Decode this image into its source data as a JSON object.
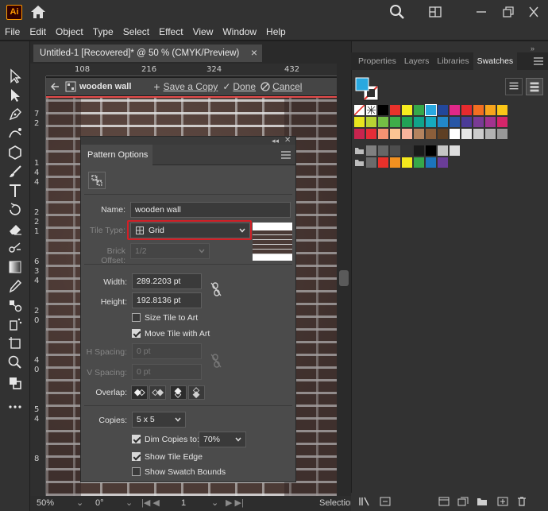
{
  "app": {
    "logo": "Ai",
    "menu": [
      "File",
      "Edit",
      "Object",
      "Type",
      "Select",
      "Effect",
      "View",
      "Window",
      "Help"
    ]
  },
  "document": {
    "tab_title": "Untitled-1 [Recovered]* @ 50 % (CMYK/Preview)",
    "close_glyph": "×"
  },
  "rulers": {
    "h_ticks": [
      "108",
      "216",
      "324",
      "432"
    ],
    "v_ticks": [
      "7",
      "2",
      "1",
      "4",
      "4",
      "2",
      "2",
      "1",
      "6",
      "3",
      "4",
      "2",
      "0",
      "4",
      "0",
      "5",
      "4",
      "8"
    ]
  },
  "pattern_bar": {
    "name": "wooden wall",
    "save_copy": "Save a Copy",
    "done": "Done",
    "cancel": "Cancel"
  },
  "status": {
    "zoom": "50%",
    "rotate": "0°",
    "page": "1",
    "tool": "Selection"
  },
  "dialog": {
    "title": "Pattern Options",
    "name_label": "Name:",
    "name_value": "wooden wall",
    "tile_type_label": "Tile Type:",
    "tile_type_value": "Grid",
    "brick_offset_label": "Brick Offset:",
    "brick_offset_value": "1/2",
    "width_label": "Width:",
    "width_value": "289.2203 pt",
    "height_label": "Height:",
    "height_value": "192.8136 pt",
    "size_tile_to_art": "Size Tile to Art",
    "move_tile_with_art": "Move Tile with Art",
    "h_spacing_label": "H Spacing:",
    "h_spacing_value": "0 pt",
    "v_spacing_label": "V Spacing:",
    "v_spacing_value": "0 pt",
    "overlap_label": "Overlap:",
    "copies_label": "Copies:",
    "copies_value": "5 x 5",
    "dim_copies_label": "Dim Copies to:",
    "dim_copies_value": "70%",
    "show_tile_edge": "Show Tile Edge",
    "show_swatch_bounds": "Show Swatch Bounds",
    "checks": {
      "size_tile_to_art": false,
      "move_tile_with_art": true,
      "dim_copies": true,
      "show_tile_edge": true,
      "show_swatch_bounds": false
    }
  },
  "right_panel": {
    "tabs": [
      "Properties",
      "Layers",
      "Libraries",
      "Swatches"
    ],
    "active_tab": "Swatches",
    "fill_color": "#29a8e0"
  },
  "swatch_rows": [
    [
      "#ffffff",
      "#ffffff",
      "#000000",
      "#e8312b",
      "#f7ec1e",
      "#36a84a",
      "#29a8e0",
      "#22479b",
      "#e02889",
      "#e72a2e",
      "#f36f21",
      "#f8a51c",
      "#fbc617"
    ],
    [
      "#e8e51e",
      "#b8d433",
      "#74bf45",
      "#3fad49",
      "#21a256",
      "#11a38a",
      "#16aabf",
      "#2288c9",
      "#2756a6",
      "#4b3b97",
      "#7a3b95",
      "#a2338f",
      "#d5256a"
    ],
    [
      "#c8244e",
      "#e62c37",
      "#f69372",
      "#fbc593",
      "#f7b39c",
      "#b4835f",
      "#8b5e3a",
      "#5e3f24",
      "#ffffff",
      "#e6e6e6",
      "#cccccc",
      "#b3b3b3",
      "#999999"
    ],
    [
      "#808080",
      "#666666",
      "#4d4d4d",
      "#333333",
      "#1a1a1a",
      "#000000",
      "#c5c5c5",
      "#dddddd"
    ],
    [
      "#6b6b6b",
      "#e8312b",
      "#f39120",
      "#f5e91d",
      "#36a84a",
      "#1c75bc",
      "#6a3d98"
    ]
  ]
}
